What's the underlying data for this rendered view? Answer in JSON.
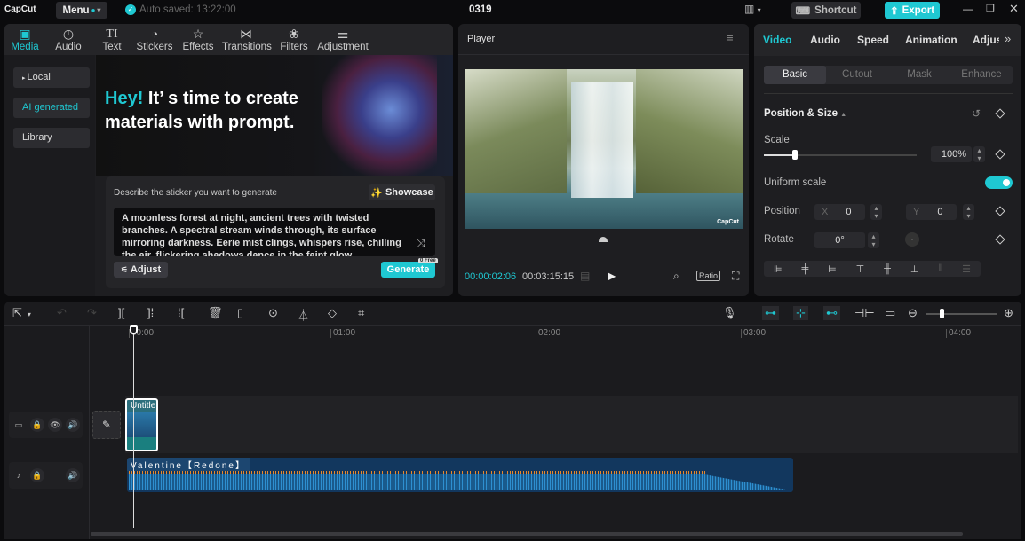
{
  "app": {
    "logo": "CapCut",
    "menu": "Menu",
    "autosave": "Auto saved: 13:22:00",
    "project": "0319",
    "shortcut": "Shortcut",
    "export": "Export"
  },
  "media_tabs": [
    {
      "label": "Media",
      "icon": "media-icon"
    },
    {
      "label": "Audio",
      "icon": "audio-icon"
    },
    {
      "label": "Text",
      "icon": "text-icon"
    },
    {
      "label": "Stickers",
      "icon": "stickers-icon"
    },
    {
      "label": "Effects",
      "icon": "effects-icon"
    },
    {
      "label": "Transitions",
      "icon": "transitions-icon"
    },
    {
      "label": "Filters",
      "icon": "filters-icon"
    },
    {
      "label": "Adjustment",
      "icon": "adjustment-icon"
    }
  ],
  "sidebar": {
    "items": [
      {
        "label": "Local"
      },
      {
        "label": "AI generated"
      },
      {
        "label": "Library"
      }
    ]
  },
  "banner": {
    "hey": "Hey!",
    "rest": " It’ s time to create materials with prompt."
  },
  "generator": {
    "label": "Describe the sticker you want to generate",
    "showcase": "Showcase",
    "prompt": "A moonless forest at night, ancient trees with twisted branches. A spectral stream winds through, its surface mirroring darkness. Eerie mist clings, whispers rise, chilling the air, flickering shadows dance in the faint glow.",
    "adjust": "Adjust",
    "generate": "Generate",
    "free_badge": "0 Free"
  },
  "player": {
    "title": "Player",
    "current": "00:00:02:06",
    "total": "00:03:15:15",
    "ratio": "Ratio",
    "watermark": "CapCut"
  },
  "inspector": {
    "tabs": [
      "Video",
      "Audio",
      "Speed",
      "Animation",
      "Adjus"
    ],
    "subtabs": [
      "Basic",
      "Cutout",
      "Mask",
      "Enhance"
    ],
    "section": "Position & Size",
    "scale_label": "Scale",
    "scale_value": "100%",
    "scale_fraction": 0.2,
    "uniform_label": "Uniform scale",
    "uniform_on": true,
    "position_label": "Position",
    "x_label": "X",
    "x_value": "0",
    "y_label": "Y",
    "y_value": "0",
    "rotate_label": "Rotate",
    "rotate_value": "0°"
  },
  "timeline": {
    "ruler": [
      "00:00",
      "01:00",
      "02:00",
      "03:00",
      "04:00"
    ],
    "video_clip": "Untitle",
    "audio_clip": "Valentine【Redone】"
  },
  "colors": {
    "accent": "#1fc8d2",
    "bg": "#0b0b0d",
    "panel": "#1e1e21"
  }
}
